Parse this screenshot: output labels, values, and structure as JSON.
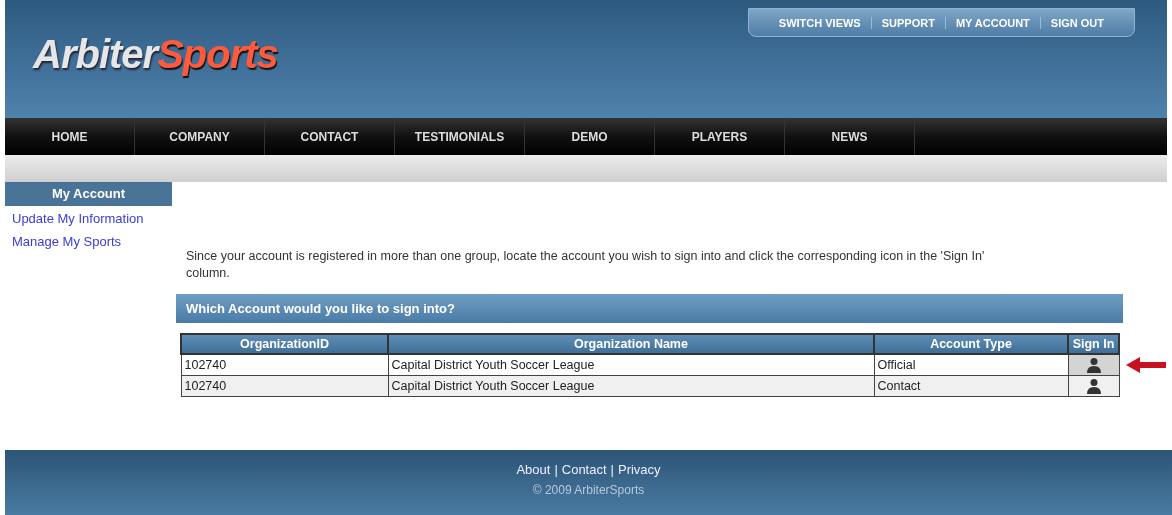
{
  "top_links": [
    "SWITCH VIEWS",
    "SUPPORT",
    "MY ACCOUNT",
    "SIGN OUT"
  ],
  "logo": {
    "part_1": "Arbiter",
    "part_2": "Sports"
  },
  "nav": [
    {
      "label": "HOME"
    },
    {
      "label": "COMPANY"
    },
    {
      "label": "CONTACT"
    },
    {
      "label": "TESTIMONIALS"
    },
    {
      "label": "DEMO"
    },
    {
      "label": "PLAYERS"
    },
    {
      "label": "NEWS"
    }
  ],
  "sidebar": {
    "title": "My Account",
    "items": [
      "Update My Information",
      "Manage My Sports"
    ]
  },
  "intro": "Since your account is registered in more than one group, locate the account you wish to sign into and click the corresponding icon in the 'Sign In' column.",
  "panel_title": "Which Account would you like to sign into?",
  "table": {
    "columns": [
      "OrganizationID",
      "Organization Name",
      "Account Type",
      "Sign In"
    ],
    "rows": [
      {
        "id": "102740",
        "name": "Capital District Youth Soccer League",
        "type": "Official",
        "pointed": true
      },
      {
        "id": "102740",
        "name": "Capital District Youth Soccer League",
        "type": "Contact",
        "pointed": false
      }
    ]
  },
  "footer": {
    "separator": "|",
    "links": [
      "About",
      "Contact",
      "Privacy"
    ],
    "copyright": "© 2009 ArbiterSports"
  }
}
